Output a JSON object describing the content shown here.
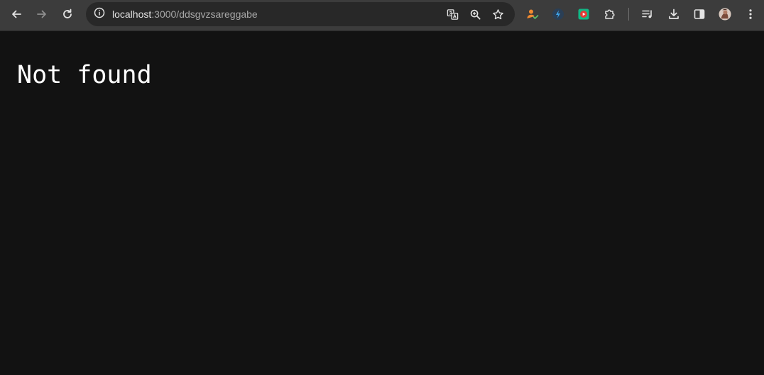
{
  "browser": {
    "url_host": "localhost",
    "url_path": ":3000/ddsgvzsareggabe",
    "icons": {
      "back": "arrow-left-icon",
      "forward": "arrow-right-icon",
      "reload": "reload-icon",
      "site_info": "info-icon",
      "translate": "translate-icon",
      "zoom": "zoom-icon",
      "bookmark": "star-icon",
      "extensions": [
        "user-check-extension-icon",
        "bolt-extension-icon",
        "video-extension-icon",
        "puzzle-icon"
      ],
      "reading_list": "reading-list-icon",
      "downloads": "download-icon",
      "side_panel": "side-panel-icon",
      "profile": "avatar",
      "menu": "kebab-menu-icon"
    },
    "colors": {
      "toolbar": "#3c3c3c",
      "omnibox": "#282828",
      "page_background": "#121212"
    }
  },
  "page": {
    "heading": "Not found"
  }
}
